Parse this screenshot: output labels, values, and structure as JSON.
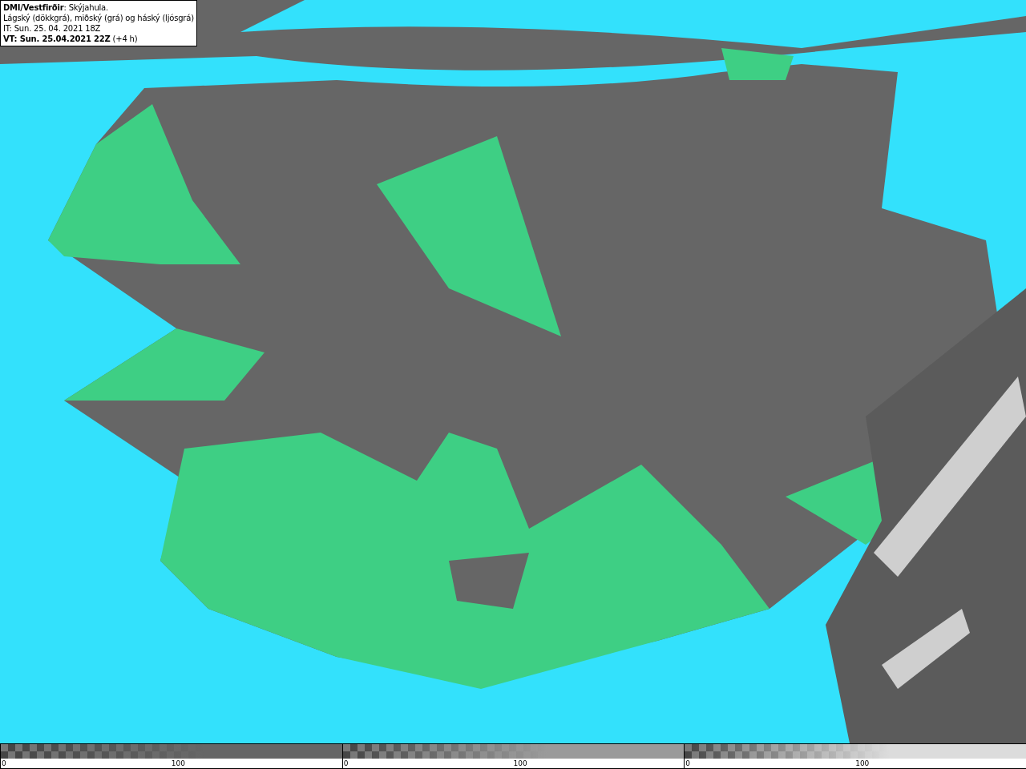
{
  "info_box": {
    "lines": [
      "**DMI/Vestfirðir**: Skýjahula.",
      "Lágský (dökkgrá), miðský (grá) og háský (ljósgrá)",
      "IT: Sun. 25. 04. 2021 18Z",
      "**VT: Sun. 25.04.2021 22Z** (+4 h)"
    ]
  },
  "legend": [
    {
      "color": "#666666",
      "min_label": "0",
      "max_label": "100"
    },
    {
      "color": "#9a9a9a",
      "min_label": "0",
      "max_label": "100"
    },
    {
      "color": "#dcdcdc",
      "min_label": "0",
      "max_label": "100"
    }
  ]
}
